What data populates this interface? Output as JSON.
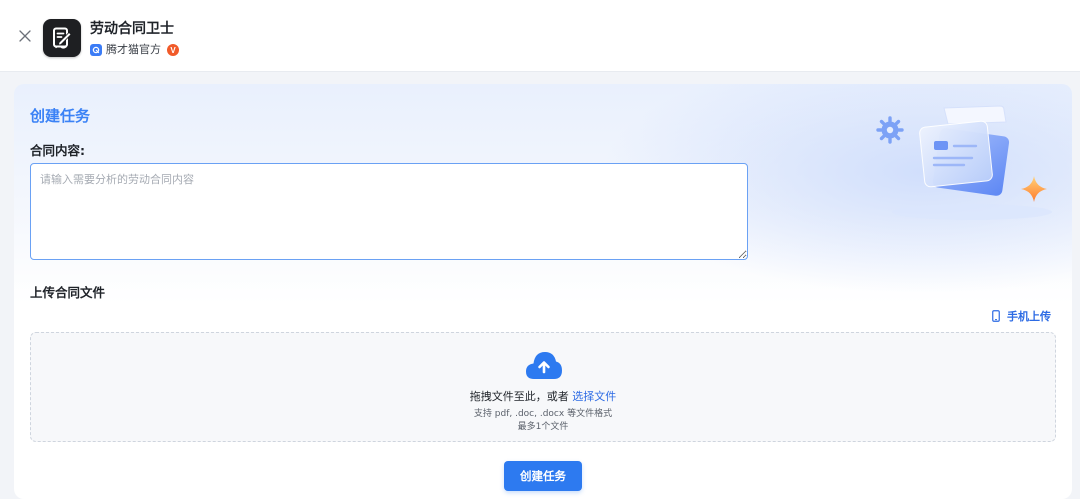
{
  "app": {
    "title": "劳动合同卫士",
    "publisher": "腾才猫官方",
    "verified_badge": "V",
    "icons": {
      "close": "close-icon",
      "logo": "contract-document-icon",
      "publisher": "publisher-badge-icon"
    }
  },
  "form": {
    "title": "创建任务",
    "content_label": "合同内容:",
    "content_value": "",
    "content_placeholder": "请输入需要分析的劳动合同内容",
    "upload_label": "上传合同文件",
    "mobile_upload_label": "手机上传",
    "drop_text": "拖拽文件至此，或者",
    "select_file_label": "选择文件",
    "supported_formats": "支持 pdf, .doc, .docx 等文件格式",
    "max_files": "最多1个文件",
    "submit_label": "创建任务"
  },
  "colors": {
    "accent": "#2d7af0",
    "title_blue": "#3b82f6",
    "verified": "#f15a29",
    "logo_bg": "#1e1f22"
  }
}
